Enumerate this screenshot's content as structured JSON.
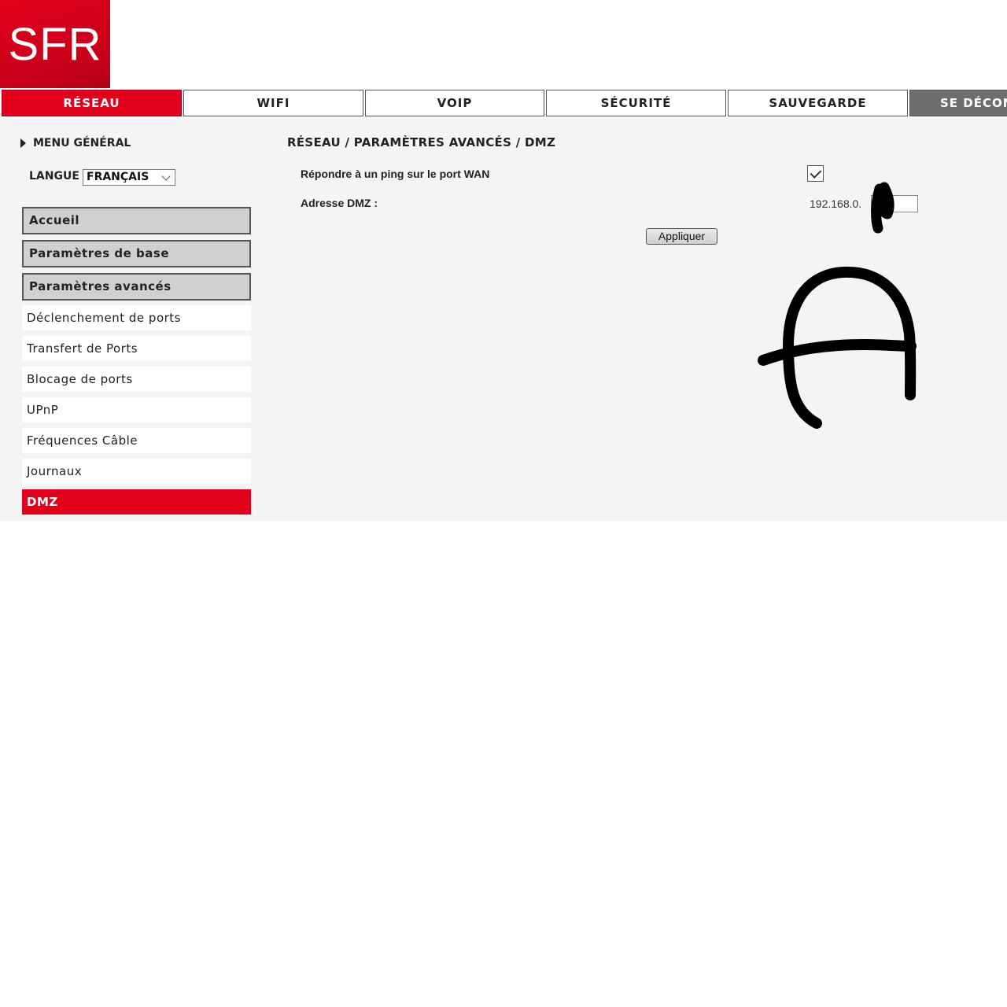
{
  "logo": {
    "text": "SFR",
    "color": "#e2001a"
  },
  "tabs": [
    {
      "label": "RÉSEAU",
      "active": true
    },
    {
      "label": "WIFI"
    },
    {
      "label": "VOIP"
    },
    {
      "label": "SÉCURITÉ"
    },
    {
      "label": "SAUVEGARDE"
    },
    {
      "label": "SE DÉCONNECTER"
    }
  ],
  "sidebar": {
    "menu_general": "MENU GÉNÉRAL",
    "langue_label": "LANGUE",
    "langue_value": "FRANÇAIS",
    "sections": [
      {
        "label": "Accueil"
      },
      {
        "label": "Paramètres de base"
      },
      {
        "label": "Paramètres avancés"
      }
    ],
    "items": [
      {
        "label": "Déclenchement de ports"
      },
      {
        "label": "Transfert de Ports"
      },
      {
        "label": "Blocage de ports"
      },
      {
        "label": "UPnP"
      },
      {
        "label": "Fréquences Câble"
      },
      {
        "label": "Journaux"
      },
      {
        "label": "DMZ",
        "active": true
      }
    ]
  },
  "main": {
    "breadcrumb": "RÉSEAU / PARAMÈTRES AVANCÉS / DMZ",
    "ping_label": "Répondre à un ping sur le port WAN",
    "ping_checked": true,
    "dmz_label": "Adresse DMZ :",
    "ip_prefix": "192.168.0.",
    "ip_value": "",
    "apply_label": "Appliquer"
  },
  "colors": {
    "accent": "#e2001a",
    "panel": "#f4f4f4",
    "section_bg": "#d0d0d0",
    "tab_dark": "#6e6e6e"
  }
}
